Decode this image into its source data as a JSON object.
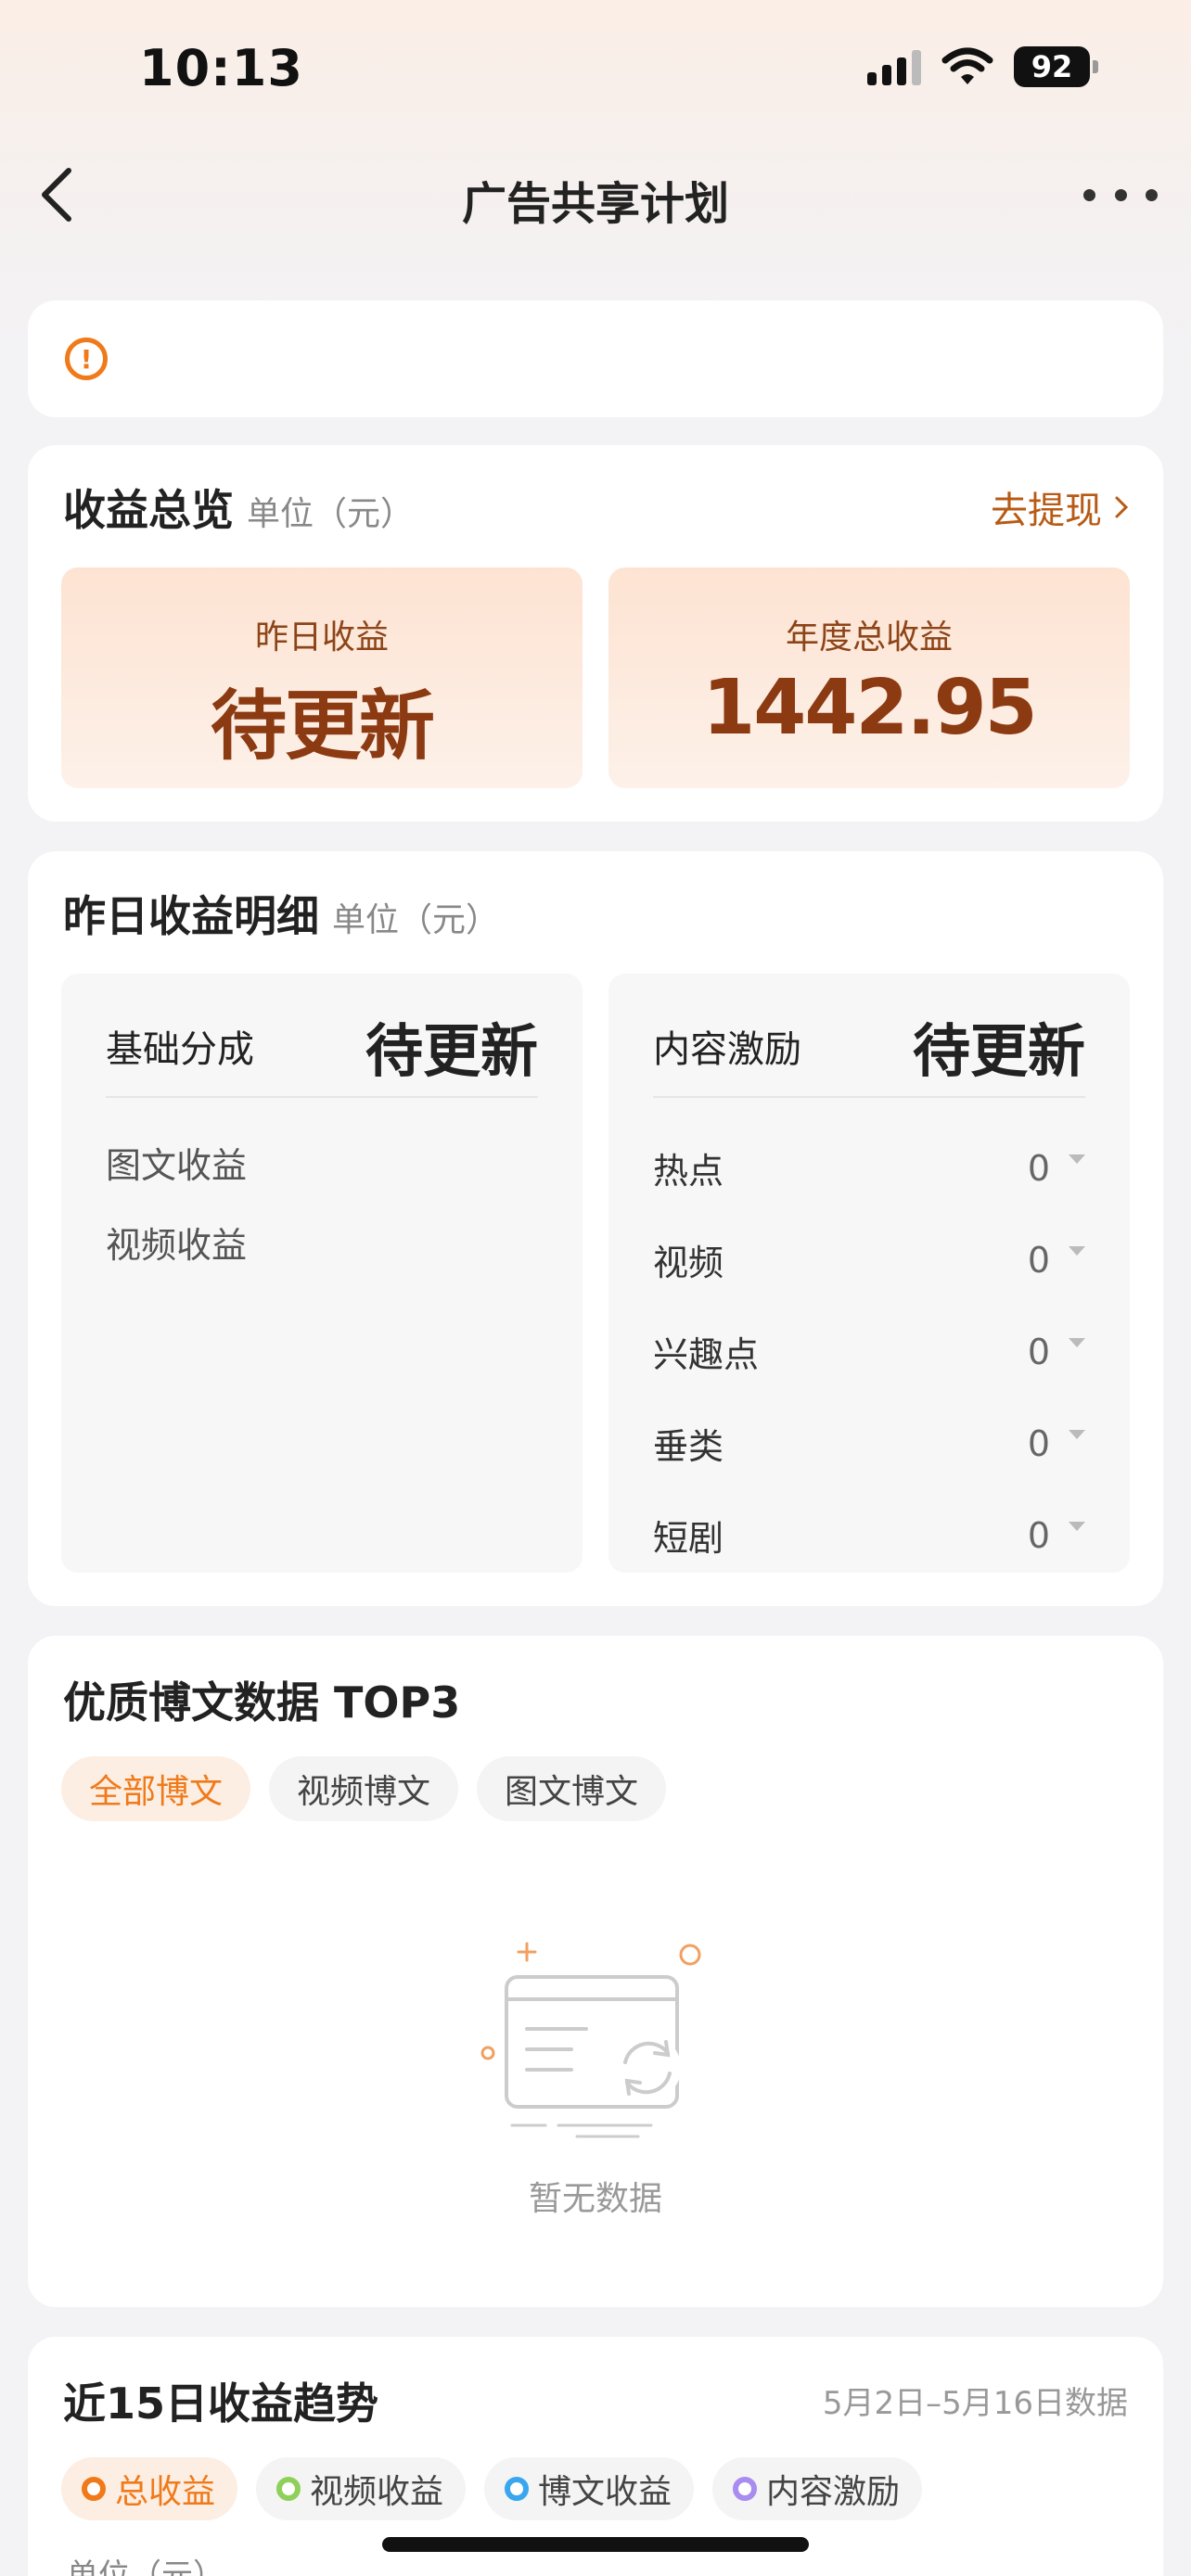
{
  "status_bar": {
    "time": "10:13",
    "battery": "92"
  },
  "nav": {
    "title": "广告共享计划"
  },
  "overview": {
    "title": "收益总览",
    "unit": "单位（元）",
    "withdraw_label": "去提现",
    "yesterday_label": "昨日收益",
    "yesterday_value": "待更新",
    "annual_label": "年度总收益",
    "annual_value": "1442.95"
  },
  "detail": {
    "title": "昨日收益明细",
    "unit": "单位（元）",
    "base": {
      "label": "基础分成",
      "value": "待更新",
      "items": [
        "图文收益",
        "视频收益"
      ]
    },
    "incentive": {
      "label": "内容激励",
      "value": "待更新",
      "items": [
        {
          "label": "热点",
          "value": "0"
        },
        {
          "label": "视频",
          "value": "0"
        },
        {
          "label": "兴趣点",
          "value": "0"
        },
        {
          "label": "垂类",
          "value": "0"
        },
        {
          "label": "短剧",
          "value": "0"
        }
      ]
    }
  },
  "top3": {
    "title": "优质博文数据 TOP3",
    "tabs": [
      "全部博文",
      "视频博文",
      "图文博文"
    ],
    "empty_text": "暂无数据"
  },
  "trend": {
    "title": "近15日收益趋势",
    "range": "5月2日–5月16日数据",
    "legend": [
      {
        "label": "总收益",
        "color": "#f07a1a"
      },
      {
        "label": "视频收益",
        "color": "#8fd05a"
      },
      {
        "label": "博文收益",
        "color": "#3aa6f0"
      },
      {
        "label": "内容激励",
        "color": "#a98cf0"
      }
    ],
    "unit": "单位（元）"
  }
}
